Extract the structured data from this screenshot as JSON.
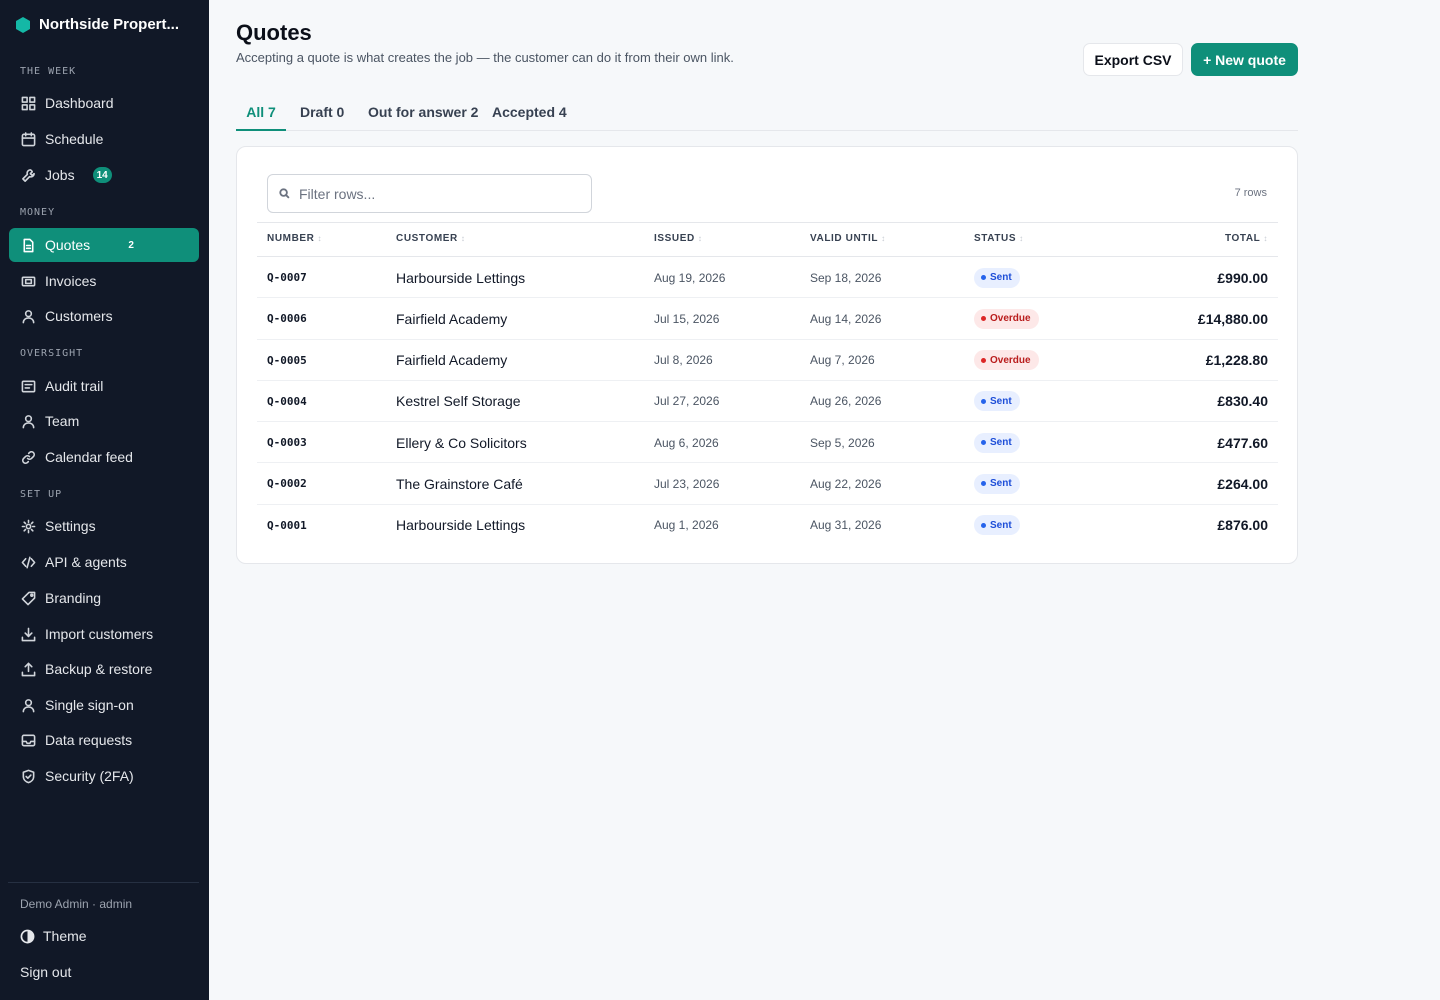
{
  "app": {
    "name": "Northside Propert..."
  },
  "sidebar": {
    "sections": [
      {
        "title": "THE WEEK",
        "items": [
          {
            "label": "Dashboard",
            "icon": "dashboard-icon"
          },
          {
            "label": "Schedule",
            "icon": "calendar-icon"
          },
          {
            "label": "Jobs",
            "icon": "wrench-icon",
            "badge": "14"
          }
        ]
      },
      {
        "title": "MONEY",
        "items": [
          {
            "label": "Quotes",
            "icon": "document-icon",
            "badge": "2",
            "active": true
          },
          {
            "label": "Invoices",
            "icon": "invoice-icon"
          },
          {
            "label": "Customers",
            "icon": "user-icon"
          }
        ]
      },
      {
        "title": "OVERSIGHT",
        "items": [
          {
            "label": "Audit trail",
            "icon": "list-icon"
          },
          {
            "label": "Team",
            "icon": "user-icon"
          },
          {
            "label": "Calendar feed",
            "icon": "link-icon"
          }
        ]
      },
      {
        "title": "SET UP",
        "items": [
          {
            "label": "Settings",
            "icon": "gear-icon"
          },
          {
            "label": "API & agents",
            "icon": "code-icon"
          },
          {
            "label": "Branding",
            "icon": "tag-icon"
          },
          {
            "label": "Import customers",
            "icon": "download-icon"
          },
          {
            "label": "Backup & restore",
            "icon": "upload-icon"
          },
          {
            "label": "Single sign-on",
            "icon": "user-icon"
          },
          {
            "label": "Data requests",
            "icon": "inbox-icon"
          },
          {
            "label": "Security (2FA)",
            "icon": "shield-icon"
          }
        ]
      }
    ],
    "user": "Demo Admin · admin",
    "theme_label": "Theme",
    "signout_label": "Sign out"
  },
  "header": {
    "title": "Quotes",
    "subtitle": "Accepting a quote is what creates the job — the customer can do it from their own link.",
    "export_label": "Export CSV",
    "new_label": "+ New quote"
  },
  "tabs": [
    {
      "label": "All 7",
      "active": true
    },
    {
      "label": "Draft 0"
    },
    {
      "label": "Out for answer 2"
    },
    {
      "label": "Accepted 4"
    }
  ],
  "filter": {
    "placeholder": "Filter rows...",
    "value": ""
  },
  "row_count": "7 rows",
  "table": {
    "columns": [
      "NUMBER",
      "CUSTOMER",
      "ISSUED",
      "VALID UNTIL",
      "STATUS",
      "TOTAL"
    ],
    "sort_glyph": "↕",
    "rows": [
      {
        "number": "Q-0007",
        "customer": "Harbourside Lettings",
        "issued": "Aug 19, 2026",
        "valid_until": "Sep 18, 2026",
        "status": "Sent",
        "status_kind": "sent",
        "total": "£990.00"
      },
      {
        "number": "Q-0006",
        "customer": "Fairfield Academy",
        "issued": "Jul 15, 2026",
        "valid_until": "Aug 14, 2026",
        "status": "Overdue",
        "status_kind": "overdue",
        "total": "£14,880.00"
      },
      {
        "number": "Q-0005",
        "customer": "Fairfield Academy",
        "issued": "Jul 8, 2026",
        "valid_until": "Aug 7, 2026",
        "status": "Overdue",
        "status_kind": "overdue",
        "total": "£1,228.80"
      },
      {
        "number": "Q-0004",
        "customer": "Kestrel Self Storage",
        "issued": "Jul 27, 2026",
        "valid_until": "Aug 26, 2026",
        "status": "Sent",
        "status_kind": "sent",
        "total": "£830.40"
      },
      {
        "number": "Q-0003",
        "customer": "Ellery & Co Solicitors",
        "issued": "Aug 6, 2026",
        "valid_until": "Sep 5, 2026",
        "status": "Sent",
        "status_kind": "sent",
        "total": "£477.60"
      },
      {
        "number": "Q-0002",
        "customer": "The Grainstore Café",
        "issued": "Jul 23, 2026",
        "valid_until": "Aug 22, 2026",
        "status": "Sent",
        "status_kind": "sent",
        "total": "£264.00"
      },
      {
        "number": "Q-0001",
        "customer": "Harbourside Lettings",
        "issued": "Aug 1, 2026",
        "valid_until": "Aug 31, 2026",
        "status": "Sent",
        "status_kind": "sent",
        "total": "£876.00"
      }
    ]
  },
  "colors": {
    "accent": "#0f8f7a",
    "sidebar_bg": "#111827",
    "page_bg": "#f6f8fa",
    "sent": "#2563eb",
    "overdue": "#dc2626"
  }
}
